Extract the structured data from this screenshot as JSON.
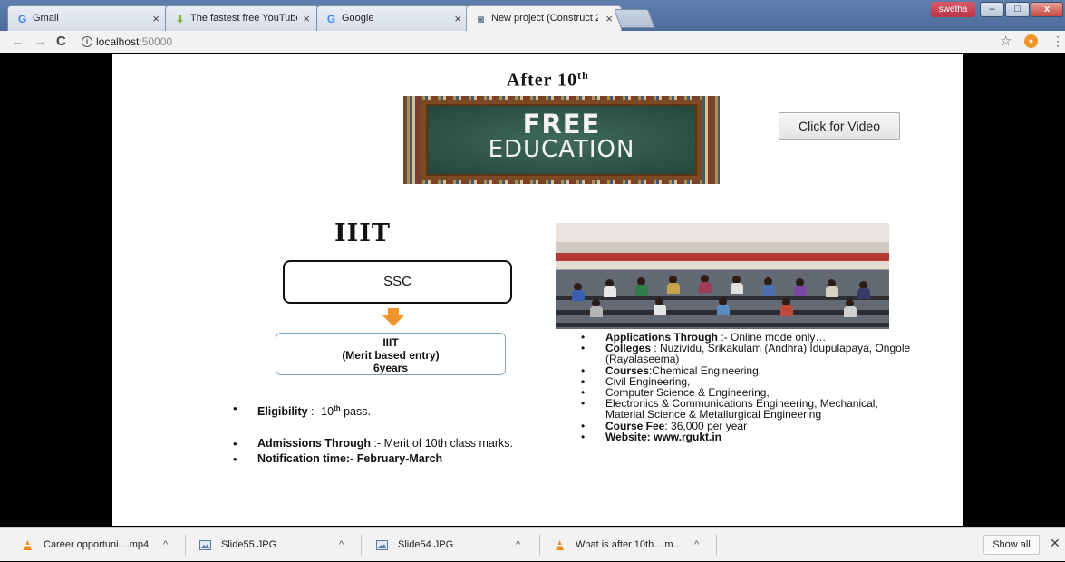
{
  "browser": {
    "tabs": [
      {
        "label": "Gmail",
        "icon": "google-g-icon"
      },
      {
        "label": "The fastest free YouTube",
        "icon": "download-arrow-icon"
      },
      {
        "label": "Google",
        "icon": "google-g-icon"
      },
      {
        "label": "New project (Construct 2",
        "icon": "construct-icon",
        "active": true
      }
    ],
    "user_badge": "swetha",
    "window_controls": {
      "minimize": "–",
      "maximize": "□",
      "close": "x"
    },
    "address": {
      "host": "localhost",
      "port": ":50000"
    }
  },
  "slide": {
    "title": "After  10",
    "title_sup": "th",
    "board_line1": "FREE",
    "board_line2": "EDUCATION",
    "video_button": "Click for Video",
    "iiit_heading": "IIIT",
    "flow": {
      "box1": "SSC",
      "box2_line1": "IIIT",
      "box2_line2": "(Merit based entry)",
      "box2_line3": "6years"
    },
    "left_bullets": [
      {
        "bold": "Eligibility",
        "text": " :- 10",
        "sup": "th",
        "tail": " pass."
      },
      {
        "bold": "Admissions Through",
        "text": " :- Merit of 10th class marks."
      },
      {
        "bold": "Notification time:-  February-March",
        "text": ""
      }
    ],
    "right_bullets": [
      {
        "bold": "Applications Through",
        "text": " :-  Online mode only…"
      },
      {
        "bold": "Colleges",
        "text": " :  Nuzividu, Srikakulam (Andhra) Idupulapaya, Ongole (Rayalaseema)"
      },
      {
        "bold": "Courses",
        "text": ":Chemical Engineering,"
      },
      {
        "bold": "",
        "text": "Civil Engineering,"
      },
      {
        "bold": "",
        "text": "Computer Science & Engineering,"
      },
      {
        "bold": "",
        "text": "Electronics & Communications Engineering, Mechanical, Material Science & Metallurgical Engineering"
      },
      {
        "bold": "Course Fee",
        "text": ": 36,000 per year"
      },
      {
        "bold": "Website:  www.rgukt.in",
        "text": ""
      }
    ]
  },
  "downloads": [
    {
      "name": "Career opportuni....mp4",
      "icon": "vlc-cone-icon"
    },
    {
      "name": "Slide55.JPG",
      "icon": "image-file-icon"
    },
    {
      "name": "Slide54.JPG",
      "icon": "image-file-icon"
    },
    {
      "name": "What is after 10th....m...",
      "icon": "vlc-cone-icon"
    }
  ],
  "show_all": "Show all",
  "colors": {
    "tabstrip": "#5e7fae",
    "toolbar": "#f2f2f2",
    "slide_bg": "#ffffff",
    "iiit_box_border": "#7ea3c9",
    "arrow": "#f0932b"
  }
}
